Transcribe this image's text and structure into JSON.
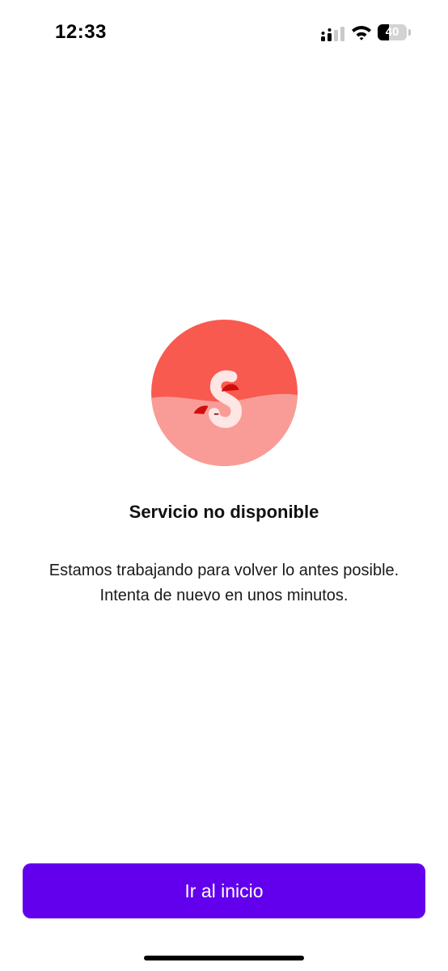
{
  "status_bar": {
    "time": "12:33",
    "signal_icon": "cellular-signal-icon",
    "wifi_icon": "wifi-icon",
    "battery_level": "40",
    "battery_fraction": 0.4
  },
  "illustration": {
    "icon": "service-unavailable-illustration",
    "colors": {
      "top": "#f85a50",
      "bottom": "#f99c97",
      "accent": "#d00d0d",
      "light": "#fde6e4"
    }
  },
  "error": {
    "title": "Servicio no disponible",
    "message_line1": "Estamos trabajando para volver lo antes posible.",
    "message_line2": "Intenta de nuevo en unos minutos."
  },
  "actions": {
    "primary_label": "Ir al inicio",
    "primary_color": "#6200ee"
  }
}
